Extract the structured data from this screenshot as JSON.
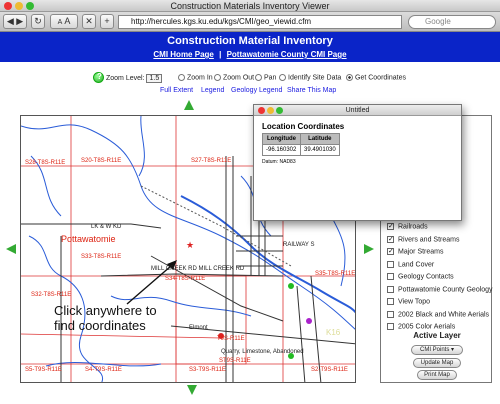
{
  "browser": {
    "window_title": "Construction Materials Inventory Viewer",
    "url": "http://hercules.kgs.ku.edu/kgs/CMI/geo_viewid.cfm",
    "search_placeholder": "Google",
    "font_small": "A",
    "font_large": "A"
  },
  "header": {
    "title": "Construction Material Inventory",
    "link_home": "CMI Home Page",
    "separator": "|",
    "link_county": "Pottawatomie County CMI Page"
  },
  "controls": {
    "zoom_label": "Zoom Level:",
    "zoom_value": "1.5",
    "options": [
      "Zoom In",
      "Zoom Out",
      "Pan",
      "Identify Site Data",
      "Get Coordinates"
    ],
    "selected_option": "Get Coordinates",
    "links": [
      "Full Extent",
      "Legend",
      "Geology Legend",
      "Share This Map"
    ]
  },
  "map": {
    "labels": {
      "t8": "S28-T8S-R11E",
      "t20": "S20-T8S-R11E",
      "t27": "S27-T8S-R11E",
      "t17": "S17-T8S-R11E",
      "lkwkd": "LK & W KD",
      "county": "Pottawatomie",
      "s33": "S33-T8S-R11E",
      "s32": "S32-T8S-R11E",
      "s34": "S34-T8S-R11E",
      "s35": "S35-T8S-R11E",
      "s5": "S5-T9S-R11E",
      "s4": "S4-T9S-R11E",
      "s3": "S3-T9S-R11E",
      "s2": "S2-T9S-R11E",
      "millcreek": "MILL CREEK RD MILL CREEK RD",
      "k16": "K16",
      "railway": "RAILWAY S",
      "elmont": "Elmont",
      "t9": "T9S-R11E",
      "quarry": "Quarry, Limestone, Abandoned",
      "qtype": "ST9S-R11E"
    },
    "callout_line1": "Click anywhere to",
    "callout_line2": "find coordinates"
  },
  "popup": {
    "title": "Untitled",
    "heading": "Location Coordinates",
    "columns": [
      "Longitude",
      "Latitude"
    ],
    "values": [
      "-96.160302",
      "39.4901030"
    ],
    "datum": "Datum: NAD83"
  },
  "panel": {
    "layers": [
      {
        "label": "Railroads",
        "checked": true
      },
      {
        "label": "Rivers and Streams",
        "checked": true
      },
      {
        "label": "Major Streams",
        "checked": true
      },
      {
        "label": "Land Cover",
        "checked": false
      },
      {
        "label": "Geology Contacts",
        "checked": false
      },
      {
        "label": "Pottawatomie County Geology",
        "checked": false
      },
      {
        "label": "View Topo",
        "checked": false
      },
      {
        "label": "2002 Black and White Aerials",
        "checked": false
      },
      {
        "label": "2005 Color Aerials",
        "checked": false
      }
    ],
    "active_layer_title": "Active Layer",
    "active_layer_value": "CMI Points",
    "update_button": "Update Map",
    "print_button": "Print Map"
  },
  "colors": {
    "banner": "#0a24c8",
    "section_lines": "#d33",
    "streams": "#2a5cd8",
    "roads": "#333333"
  }
}
